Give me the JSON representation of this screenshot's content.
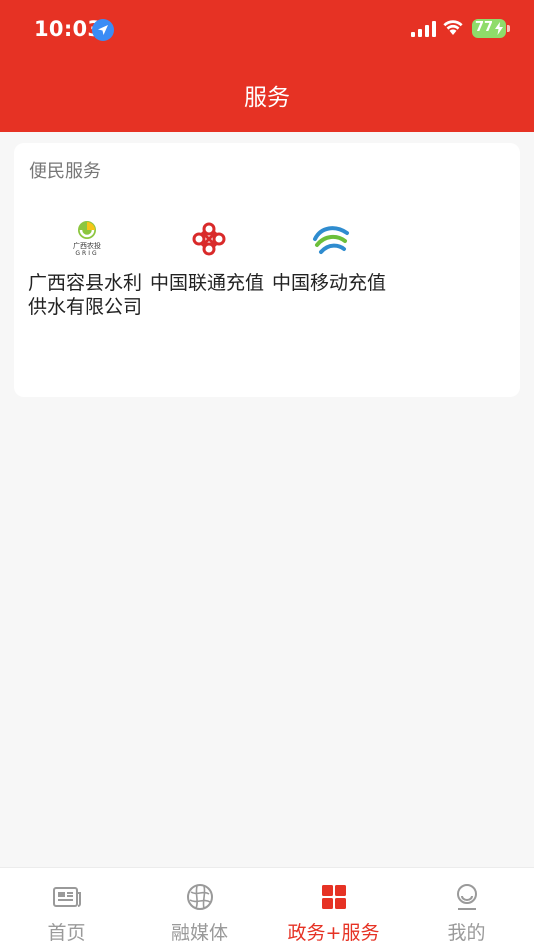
{
  "status_bar": {
    "time": "10:03",
    "battery": "77"
  },
  "header": {
    "title": "服务"
  },
  "section": {
    "title": "便民服务"
  },
  "services": [
    {
      "label": "广西容县水利供水有限公司",
      "logo_text": "广西农投",
      "logo_subtext": "GRIG",
      "icon": "grig-logo-icon"
    },
    {
      "label": "中国联通充值",
      "icon": "china-unicom-icon"
    },
    {
      "label": "中国移动充值",
      "icon": "china-mobile-icon"
    }
  ],
  "tabbar": {
    "items": [
      {
        "label": "首页",
        "icon": "newspaper-icon"
      },
      {
        "label": "融媒体",
        "icon": "globe-icon"
      },
      {
        "label": "政务+服务",
        "icon": "grid-icon"
      },
      {
        "label": "我的",
        "icon": "profile-icon"
      }
    ],
    "active_index": 2
  },
  "colors": {
    "accent": "#e63224",
    "inactive": "#9a9a9a",
    "background": "#f7f7f7"
  }
}
